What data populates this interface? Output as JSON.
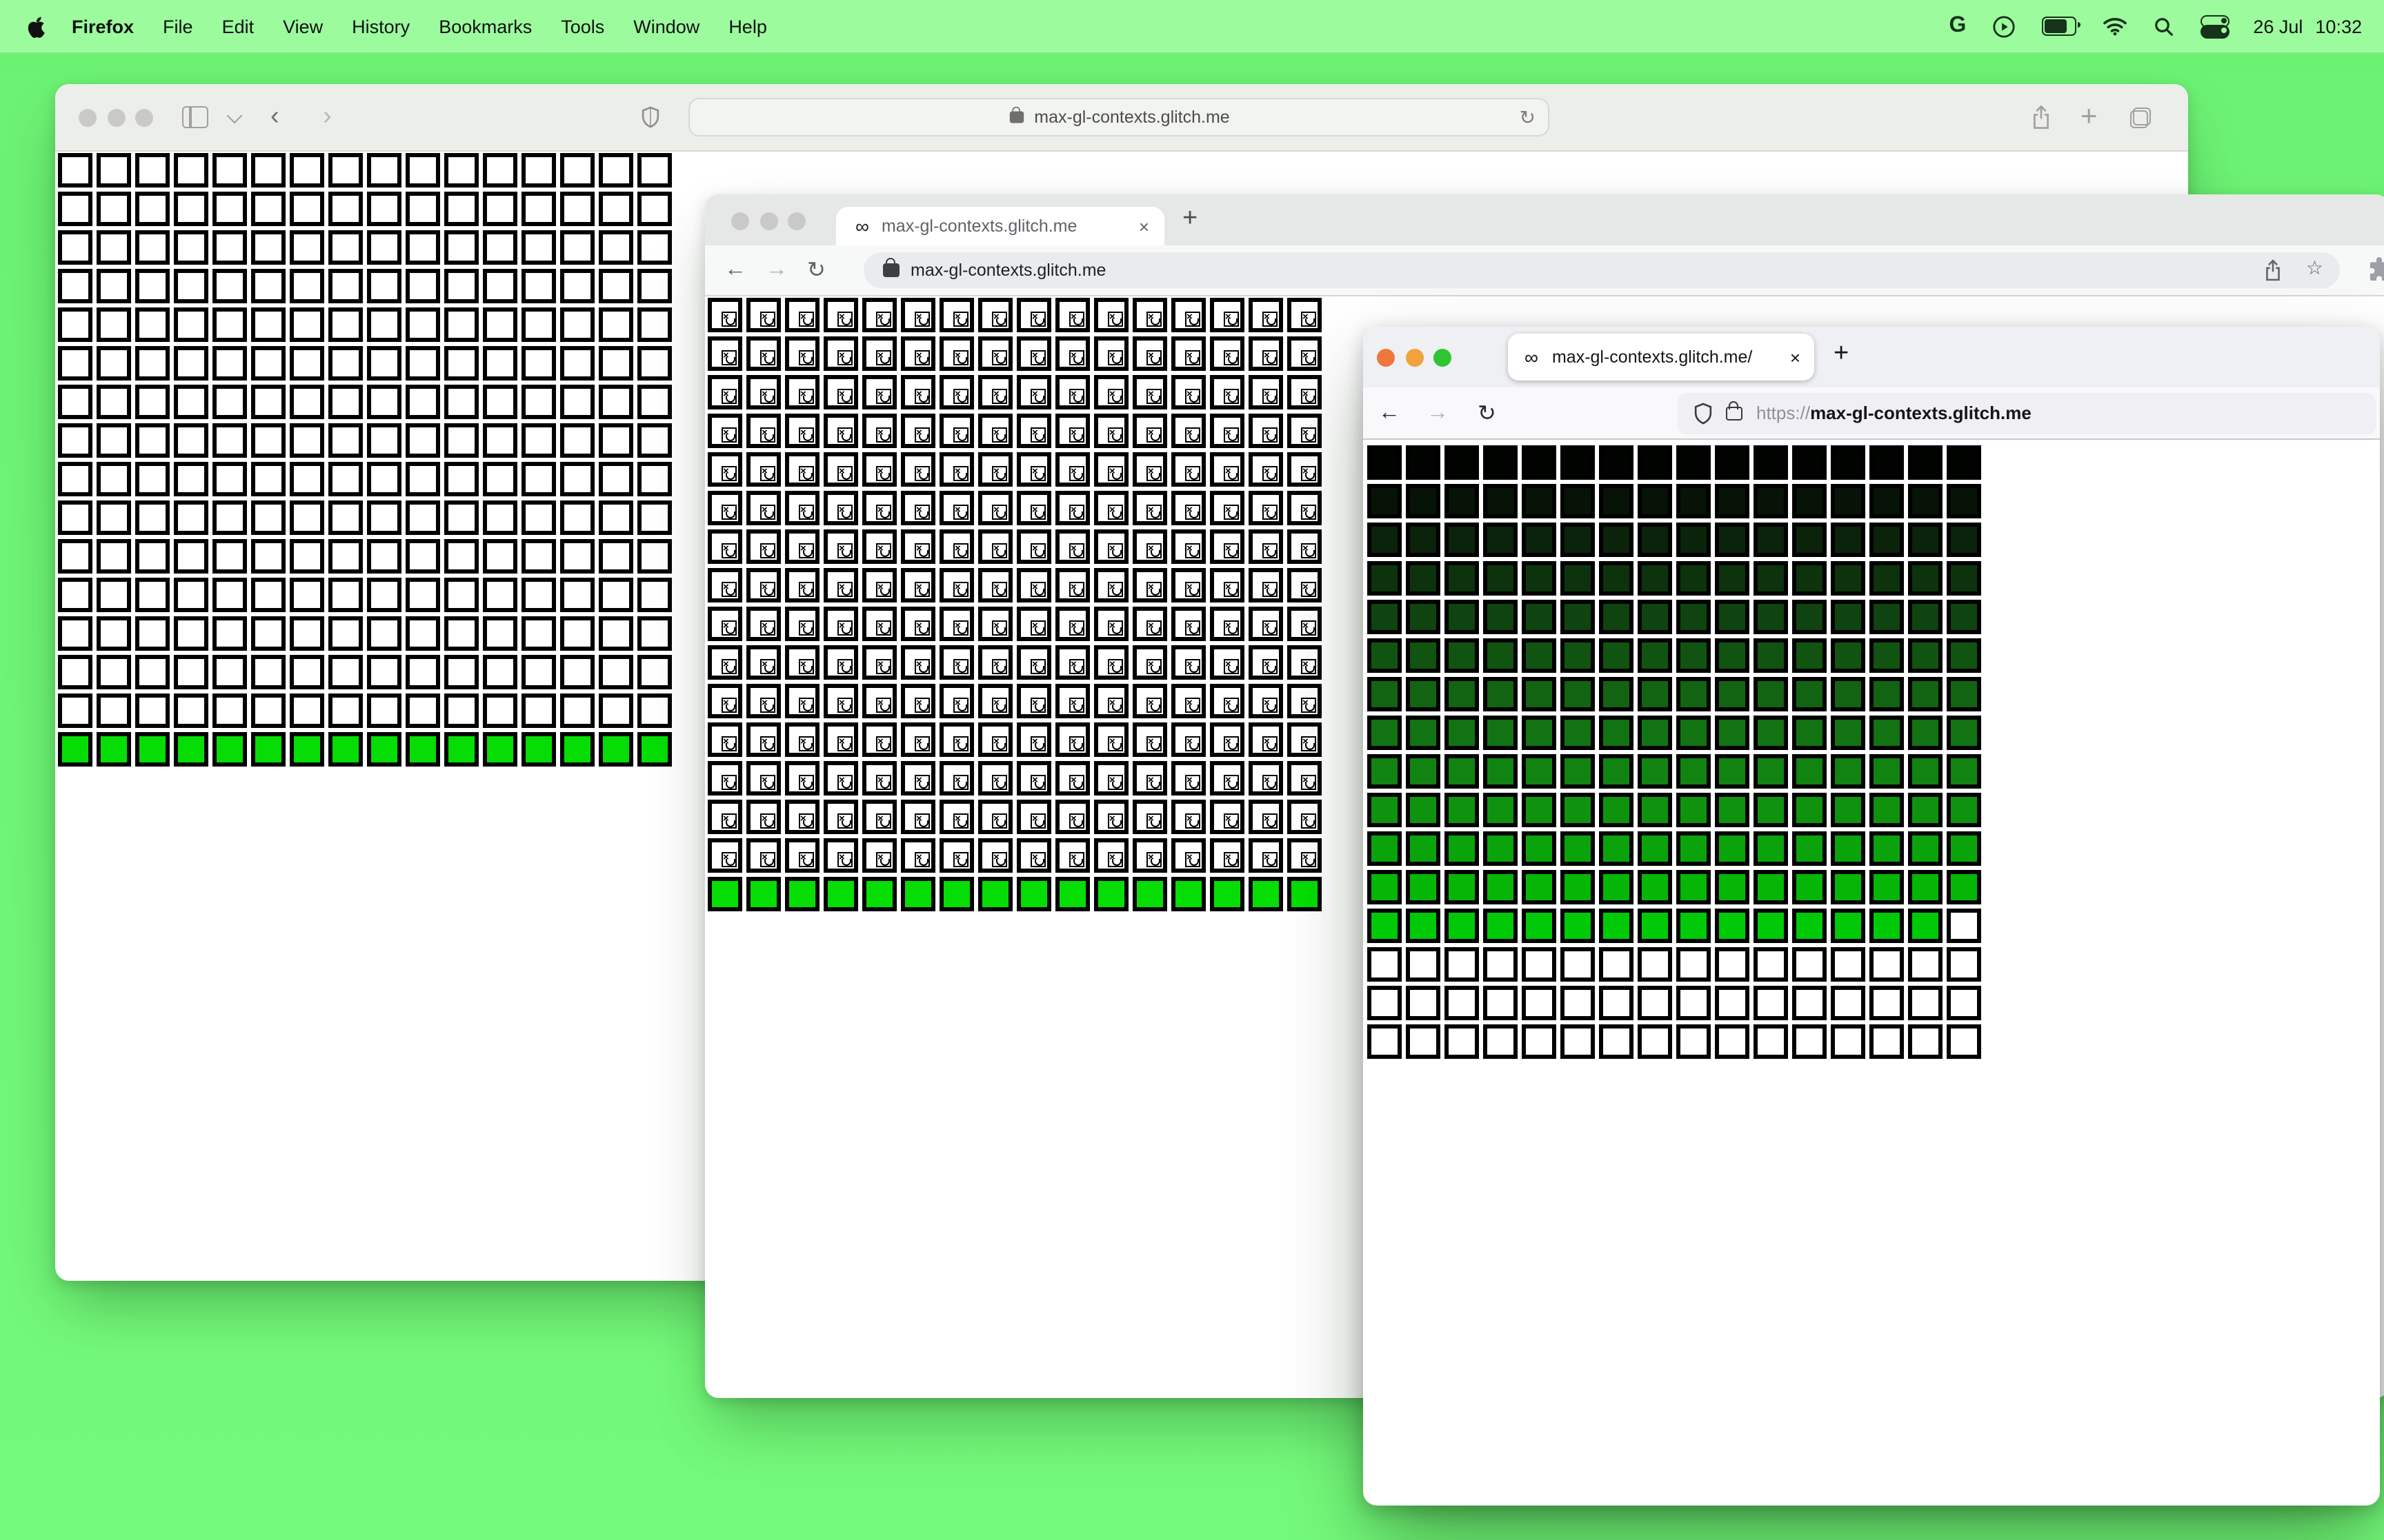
{
  "menu_bar": {
    "app_name": "Firefox",
    "items": [
      "File",
      "Edit",
      "View",
      "History",
      "Bookmarks",
      "Tools",
      "Window",
      "Help"
    ],
    "status": {
      "google_label": "G",
      "date": "26 Jul",
      "time": "10:32"
    }
  },
  "safari": {
    "url": "max-gl-contexts.glitch.me",
    "reload_glyph": "↻"
  },
  "chrome": {
    "favicon_glyph": "∞",
    "tab_title": "max-gl-contexts.glitch.me",
    "close_glyph": "×",
    "new_tab_glyph": "+",
    "back_glyph": "←",
    "forward_glyph": "→",
    "reload_glyph": "↻",
    "url": "max-gl-contexts.glitch.me",
    "star_glyph": "☆"
  },
  "firefox": {
    "favicon_glyph": "∞",
    "tab_title": "max-gl-contexts.glitch.me/",
    "close_glyph": "×",
    "new_tab_glyph": "+",
    "back_glyph": "←",
    "forward_glyph": "→",
    "reload_glyph": "↻",
    "url_scheme": "https://",
    "url_host": "max-gl-contexts.glitch.me"
  },
  "colors": {
    "desktop_green": "#6ef475",
    "menubar_green": "#9bfb9d",
    "cell_green": "#05dd05",
    "inactive_light": "#c9c9c7",
    "ff_light_close": "#f0773c",
    "ff_light_min": "#f0a33c",
    "ff_light_zoom": "#2fc432"
  },
  "grids": {
    "safari": {
      "cols": 16,
      "rows": [
        {
          "fill": "#ffffff",
          "count": 15
        },
        {
          "fill": "#05dd05",
          "count": 1
        }
      ]
    },
    "chrome": {
      "cols": 16,
      "rows": [
        {
          "type": "broken",
          "fill": "#ffffff",
          "count": 15
        },
        {
          "fill": "#05dd05",
          "count": 1
        }
      ]
    },
    "firefox": {
      "cols": 16,
      "rows": [
        {
          "fill": "#000300"
        },
        {
          "fill": "#061306"
        },
        {
          "fill": "#0a230a"
        },
        {
          "fill": "#0d330d"
        },
        {
          "fill": "#0f430f"
        },
        {
          "fill": "#115311"
        },
        {
          "fill": "#126312"
        },
        {
          "fill": "#127312"
        },
        {
          "fill": "#118311"
        },
        {
          "fill": "#0f930f"
        },
        {
          "fill": "#0ba30b"
        },
        {
          "fill": "#06b606"
        },
        {
          "fill": "#00c908",
          "last_cell": "#ffffff"
        },
        {
          "fill": "#ffffff",
          "count": 3
        }
      ]
    }
  }
}
